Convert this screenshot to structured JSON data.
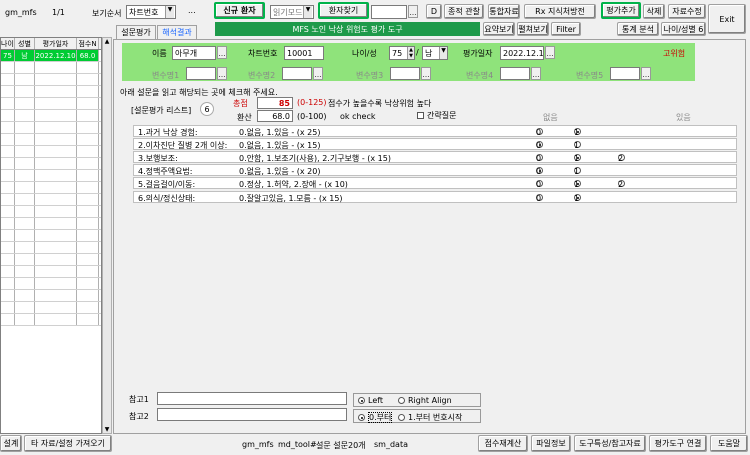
{
  "app_name": "gm_mfs",
  "page_indicator": "1/1",
  "view_order_label": "보기순서",
  "view_order_value": "차트번호",
  "more_dots": "...",
  "new_patient_label": "신규 환자",
  "read_mode_value": "읽기모드",
  "find_patient_label": "환자찾기",
  "d_label": "D",
  "integrated_btn": "종적 관찰",
  "integrated_data_btn": "통합자료",
  "rx_btn": "Rx 지식처방전",
  "eval_add_btn": "평가추가",
  "delete_btn": "삭제",
  "edit_btn": "자료수정",
  "exit_btn": "Exit",
  "tabs": [
    "설문평가",
    "해석결과"
  ],
  "banner_title": "MFS 노인 낙상 위험도 평가 도구",
  "summary_btn": "요약보기",
  "expand_btn": "펼쳐보기",
  "filter_btn": "Filter",
  "stats_btn": "통계 분석",
  "age_sex_btn": "나이/성별 6",
  "grid": {
    "headers": [
      "나이",
      "성별",
      "평가일자",
      "점수N"
    ],
    "rows": [
      [
        "75",
        "남",
        "2022.12.10",
        "68.0"
      ]
    ]
  },
  "form": {
    "name_label": "이름",
    "name_value": "아무개",
    "chart_label": "차트번호",
    "chart_value": "10001",
    "age_sex_label": "나이/성",
    "age_value": "75",
    "sex_value": "남",
    "eval_date_label": "평가일자",
    "eval_date_value": "2022.12.10",
    "risk_label": "고위험",
    "var_labels": [
      "변수명1",
      "변수명2",
      "변수명3",
      "변수명4",
      "변수명5"
    ]
  },
  "instruction": "아래 설문을 읽고 해당되는 곳에 체크해 주세요.",
  "list_label": "[설문평가 리스트]",
  "list_count": "6",
  "total_label": "총점",
  "total_value": "85",
  "total_range": "(0-125)",
  "total_desc": "점수가 높을수록 낙상위험 높다",
  "converted_label": "환산",
  "converted_value": "68.0",
  "converted_range": "(0-100)",
  "converted_desc": "ok check",
  "brief_label": "간략질문",
  "col_none": "없음",
  "col_yes": "있음",
  "questions": [
    {
      "q": "1.과거 낙상 경험:",
      "a": "0.없음, 1.있음 - (x 25)",
      "opts": [
        "0",
        "1"
      ],
      "sel": 1
    },
    {
      "q": "2.이차진단 질병 2개 이상:",
      "a": "0.없음, 1.있음 - (x 15)",
      "opts": [
        "0",
        "1"
      ],
      "sel": 0
    },
    {
      "q": "3.보행보조:",
      "a": "0.안함, 1.보조기(사용), 2.기구보행 - (x 15)",
      "opts": [
        "0",
        "1",
        "2"
      ],
      "sel": 1
    },
    {
      "q": "4.정맥주액요법:",
      "a": "0.없음, 1.있음 - (x 20)",
      "opts": [
        "0",
        "1"
      ],
      "sel": 0
    },
    {
      "q": "5.걸음걸이/이동:",
      "a": "0.정상, 1.허약, 2.장애 - (x 10)",
      "opts": [
        "0",
        "1",
        "2"
      ],
      "sel": 1
    },
    {
      "q": "6.의식/정신상태:",
      "a": "0.잘알고있음, 1.모름 - (x 15)",
      "opts": [
        "0",
        "1"
      ],
      "sel": 1
    }
  ],
  "note1_label": "참고1",
  "note2_label": "참고2",
  "align_left": "Left",
  "align_right": "Right Align",
  "start_zero": "0.부터",
  "start_one": "1.부터 번호시작",
  "bottom": {
    "settings": "설계",
    "other_data": "타 자료/설정 가져오기",
    "status": [
      "gm_mfs",
      "md_tool#",
      "설문 설문20개",
      "sm_data"
    ],
    "score_calc": "점수재계산",
    "file_info": "파일정보",
    "tool_info": "도구특성/참고자료",
    "link": "평가도구 연결",
    "help": "도움말"
  },
  "colors": {
    "green_panel": "#8fe37b",
    "banner": "#1e9a4a",
    "selected_row": "#00cc33",
    "risk_red": "#cc0000"
  }
}
